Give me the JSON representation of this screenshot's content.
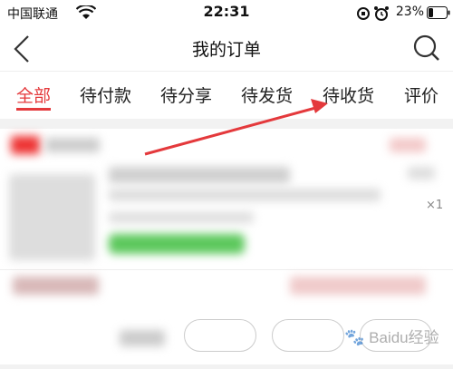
{
  "status_bar": {
    "carrier": "中国联通",
    "time": "22:31",
    "battery": "23%"
  },
  "header": {
    "title": "我的订单"
  },
  "tabs": [
    {
      "label": "全部",
      "active": true
    },
    {
      "label": "待付款",
      "active": false
    },
    {
      "label": "待分享",
      "active": false
    },
    {
      "label": "待发货",
      "active": false
    },
    {
      "label": "待收货",
      "active": false
    },
    {
      "label": "评价",
      "active": false
    }
  ],
  "order": {
    "quantity": "×1"
  },
  "watermark": {
    "text": "Baidu经验"
  },
  "colors": {
    "accent": "#e4393c",
    "green_badge": "#5cc85c"
  }
}
